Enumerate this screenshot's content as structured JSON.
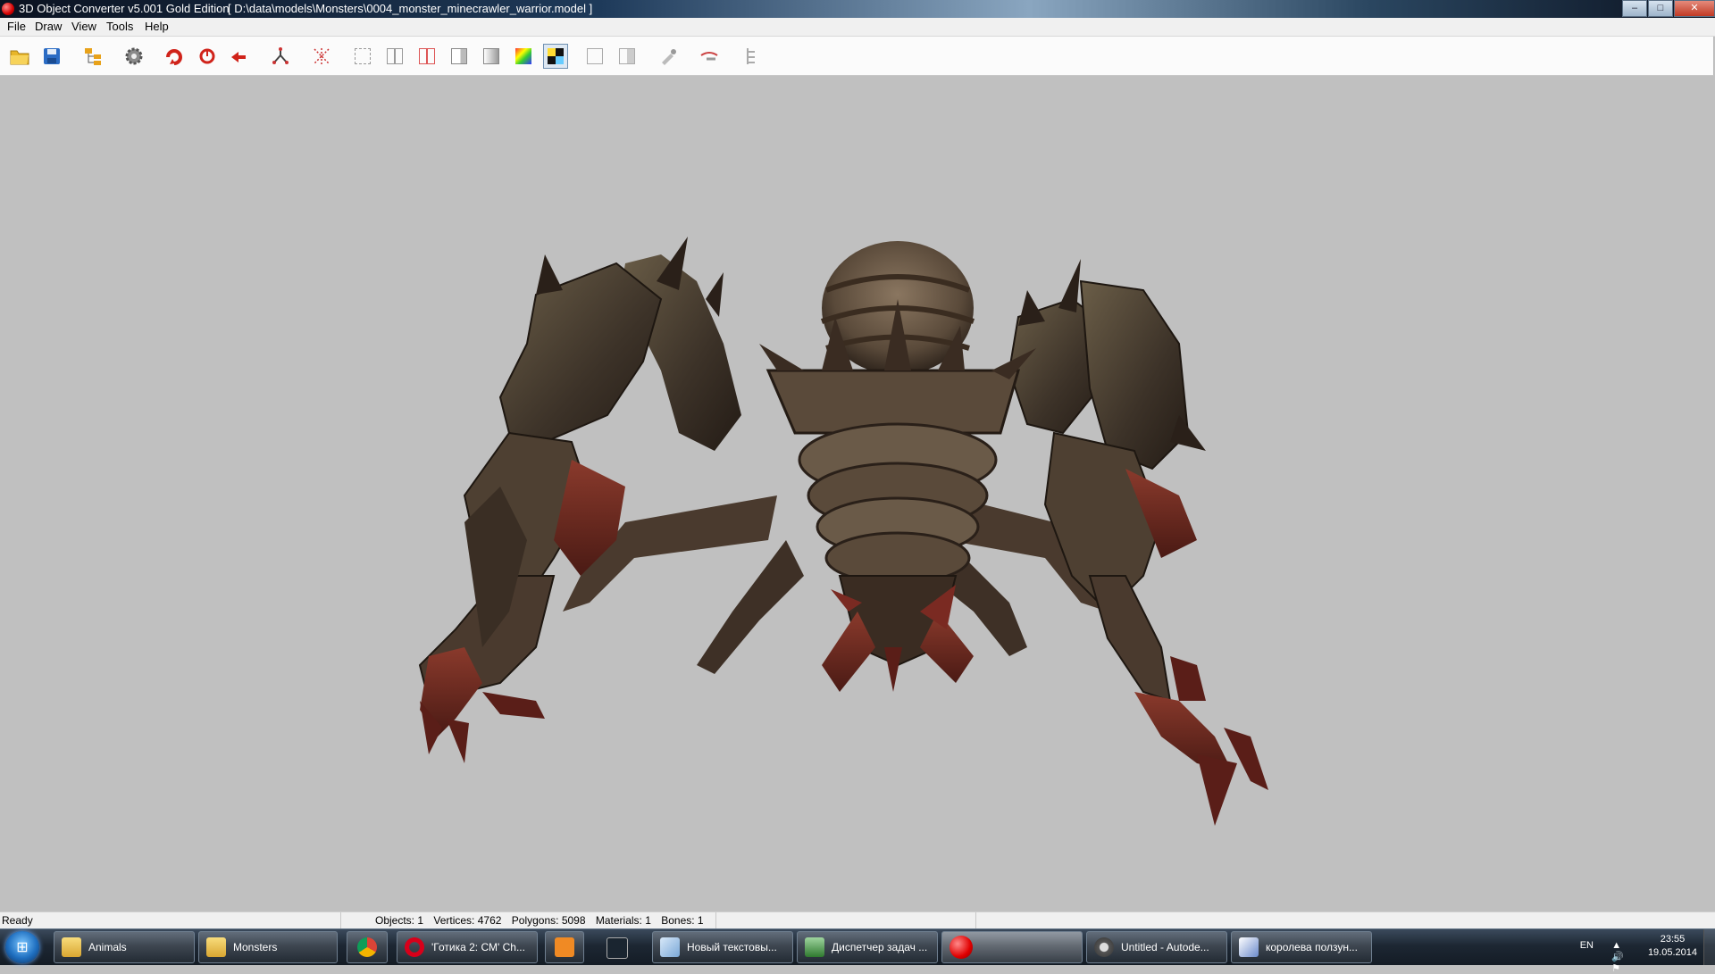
{
  "window": {
    "title": "3D Object Converter v5.001 Gold Edition",
    "path": "[ D:\\data\\models\\Monsters\\0004_monster_minecrawler_warrior.model ]",
    "buttons": {
      "minimize": "–",
      "maximize": "□",
      "close": "✕"
    }
  },
  "menu": [
    "File",
    "Draw",
    "View",
    "Tools",
    "Help"
  ],
  "toolbar": {
    "tools": [
      {
        "icon": "open-folder-icon"
      },
      {
        "icon": "save-icon"
      },
      {
        "icon": "tree-icon"
      },
      {
        "icon": "settings-gear-icon"
      },
      {
        "icon": "rotate-icon"
      },
      {
        "icon": "orbit-icon"
      },
      {
        "icon": "pan-icon"
      },
      {
        "icon": "bones-icon"
      },
      {
        "icon": "axes-icon"
      },
      {
        "icon": "wireframe-front-icon"
      },
      {
        "icon": "wireframe-side-icon"
      },
      {
        "icon": "wireframe-red-icon"
      },
      {
        "icon": "flat-shade-icon"
      },
      {
        "icon": "smooth-shade-icon"
      },
      {
        "icon": "color-shade-icon"
      },
      {
        "icon": "texture-icon"
      },
      {
        "icon": "normals-icon"
      },
      {
        "icon": "normals-alt-icon"
      },
      {
        "icon": "paint-icon"
      },
      {
        "icon": "brush-icon"
      },
      {
        "icon": "hierarchy-icon"
      }
    ],
    "pressed": "texture-icon"
  },
  "status": {
    "ready": "Ready",
    "objects": "Objects: 1",
    "vertices": "Vertices: 4762",
    "polygons": "Polygons: 5098",
    "materials": "Materials: 1",
    "bones": "Bones: 1"
  },
  "taskbar": {
    "items": [
      {
        "label": "Animals",
        "icon": "folder-icon"
      },
      {
        "label": "Monsters",
        "icon": "folder-icon"
      },
      {
        "label": "",
        "icon": "chrome-icon"
      },
      {
        "label": "'Готика 2: СМ' Ch...",
        "icon": "opera-icon"
      },
      {
        "label": "",
        "icon": "media-player-icon"
      },
      {
        "label": "",
        "icon": "monitor-icon"
      },
      {
        "label": "Новый текстовы...",
        "icon": "notepad-icon"
      },
      {
        "label": "Диспетчер задач ...",
        "icon": "task-manager-icon"
      },
      {
        "label": "",
        "icon": "converter-icon"
      },
      {
        "label": "Untitled - Autode...",
        "icon": "autodesk-icon"
      },
      {
        "label": "королева ползун...",
        "icon": "paint-icon"
      }
    ],
    "tray": {
      "lang": "EN",
      "time": "23:55",
      "date": "19.05.2014"
    }
  },
  "colors": {
    "viewport_bg": "#c0c0c0",
    "creature_dark": "#3a2e26",
    "creature_mid": "#6a5a48",
    "creature_red": "#7a2a22"
  }
}
